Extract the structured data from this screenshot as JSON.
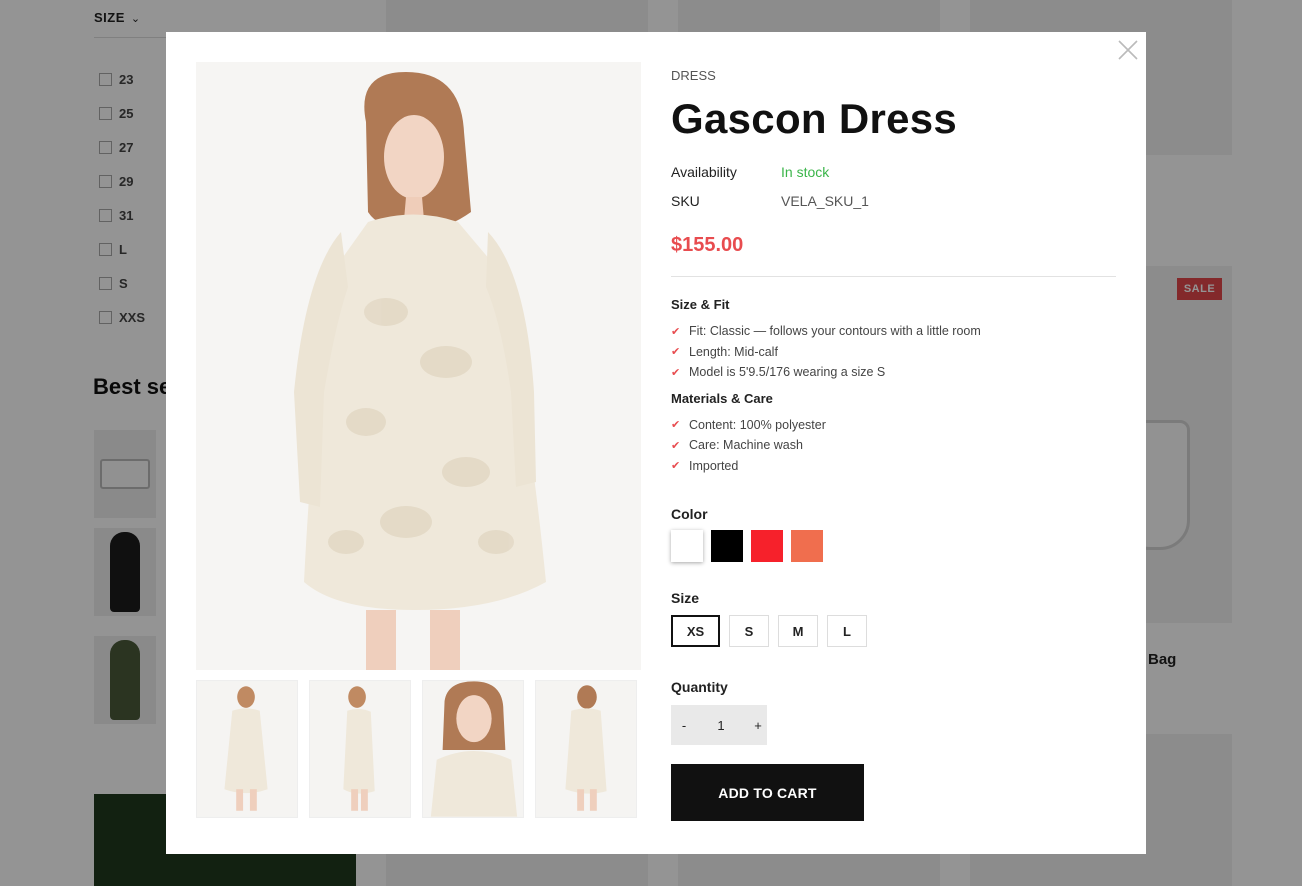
{
  "background": {
    "filter": {
      "title": "SIZE",
      "chevron_icon": "chevron-down-icon",
      "options": [
        "23",
        "25",
        "27",
        "29",
        "31",
        "L",
        "S",
        "XXS"
      ]
    },
    "best_sellers_title": "Best se",
    "sale_badge": "SALE",
    "product_title_fragment": "Bag"
  },
  "modal": {
    "close_icon": "close-icon",
    "category": "DRESS",
    "title": "Gascon Dress",
    "availability_label": "Availability",
    "availability_value": "In stock",
    "sku_label": "SKU",
    "sku_value": "VELA_SKU_1",
    "price": "$155.00",
    "size_fit_title": "Size & Fit",
    "size_fit_items": [
      "Fit: Classic — follows your contours with a little room",
      "Length: Mid-calf",
      "Model is 5'9.5/176 wearing a size S"
    ],
    "materials_title": "Materials & Care",
    "materials_items": [
      "Content: 100% polyester",
      "Care: Machine wash",
      "Imported"
    ],
    "color_label": "Color",
    "colors": [
      "#ffffff",
      "#000000",
      "#f6212b",
      "#f06e4e"
    ],
    "size_label": "Size",
    "sizes": [
      "XS",
      "S",
      "M",
      "L"
    ],
    "selected_size": "XS",
    "quantity_label": "Quantity",
    "quantity_minus": "-",
    "quantity_value": "1",
    "quantity_plus": "+",
    "add_to_cart": "ADD TO CART",
    "accent_color": "#e84c4f",
    "stock_color": "#3bb54a"
  }
}
